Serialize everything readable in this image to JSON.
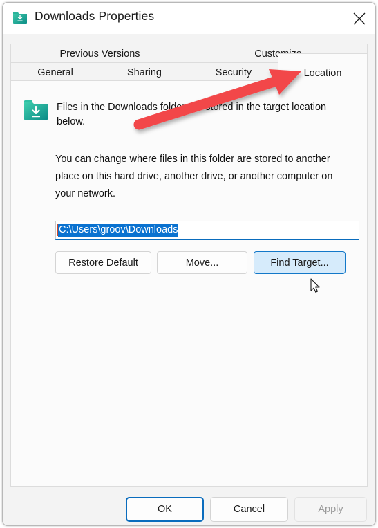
{
  "window": {
    "title": "Downloads Properties",
    "icon": "downloads-folder-icon",
    "close_label": "×"
  },
  "tabs": {
    "row1": [
      {
        "label": "Previous Versions",
        "active": false
      },
      {
        "label": "Customize",
        "active": false
      }
    ],
    "row2": [
      {
        "label": "General",
        "active": false
      },
      {
        "label": "Sharing",
        "active": false
      },
      {
        "label": "Security",
        "active": false
      },
      {
        "label": "Location",
        "active": true
      }
    ]
  },
  "content": {
    "folder_icon": "downloads-folder-icon",
    "intro_text": "Files in the Downloads folder are stored in the target location below.",
    "description_text": "You can change where files in this folder are stored to another place on this hard drive, another drive, or another computer on your network.",
    "path_input": {
      "value": "C:\\Users\\groov\\Downloads",
      "placeholder": "",
      "selected": true
    },
    "buttons": [
      {
        "label": "Restore Default",
        "state": "normal"
      },
      {
        "label": "Move...",
        "state": "normal"
      },
      {
        "label": "Find Target...",
        "state": "focused"
      }
    ]
  },
  "footer": {
    "ok_label": "OK",
    "cancel_label": "Cancel",
    "apply_label": "Apply",
    "apply_disabled": true
  },
  "annotation": {
    "type": "red-arrow",
    "color": "#f2474a",
    "points_to": "Location"
  },
  "colors": {
    "accent": "#0a6cbd",
    "selection": "#0a72d0",
    "folder_teal": "#16a085",
    "annotation_red": "#f2474a",
    "window_bg": "#f3f3f3",
    "panel_bg": "#fbfbfb"
  }
}
